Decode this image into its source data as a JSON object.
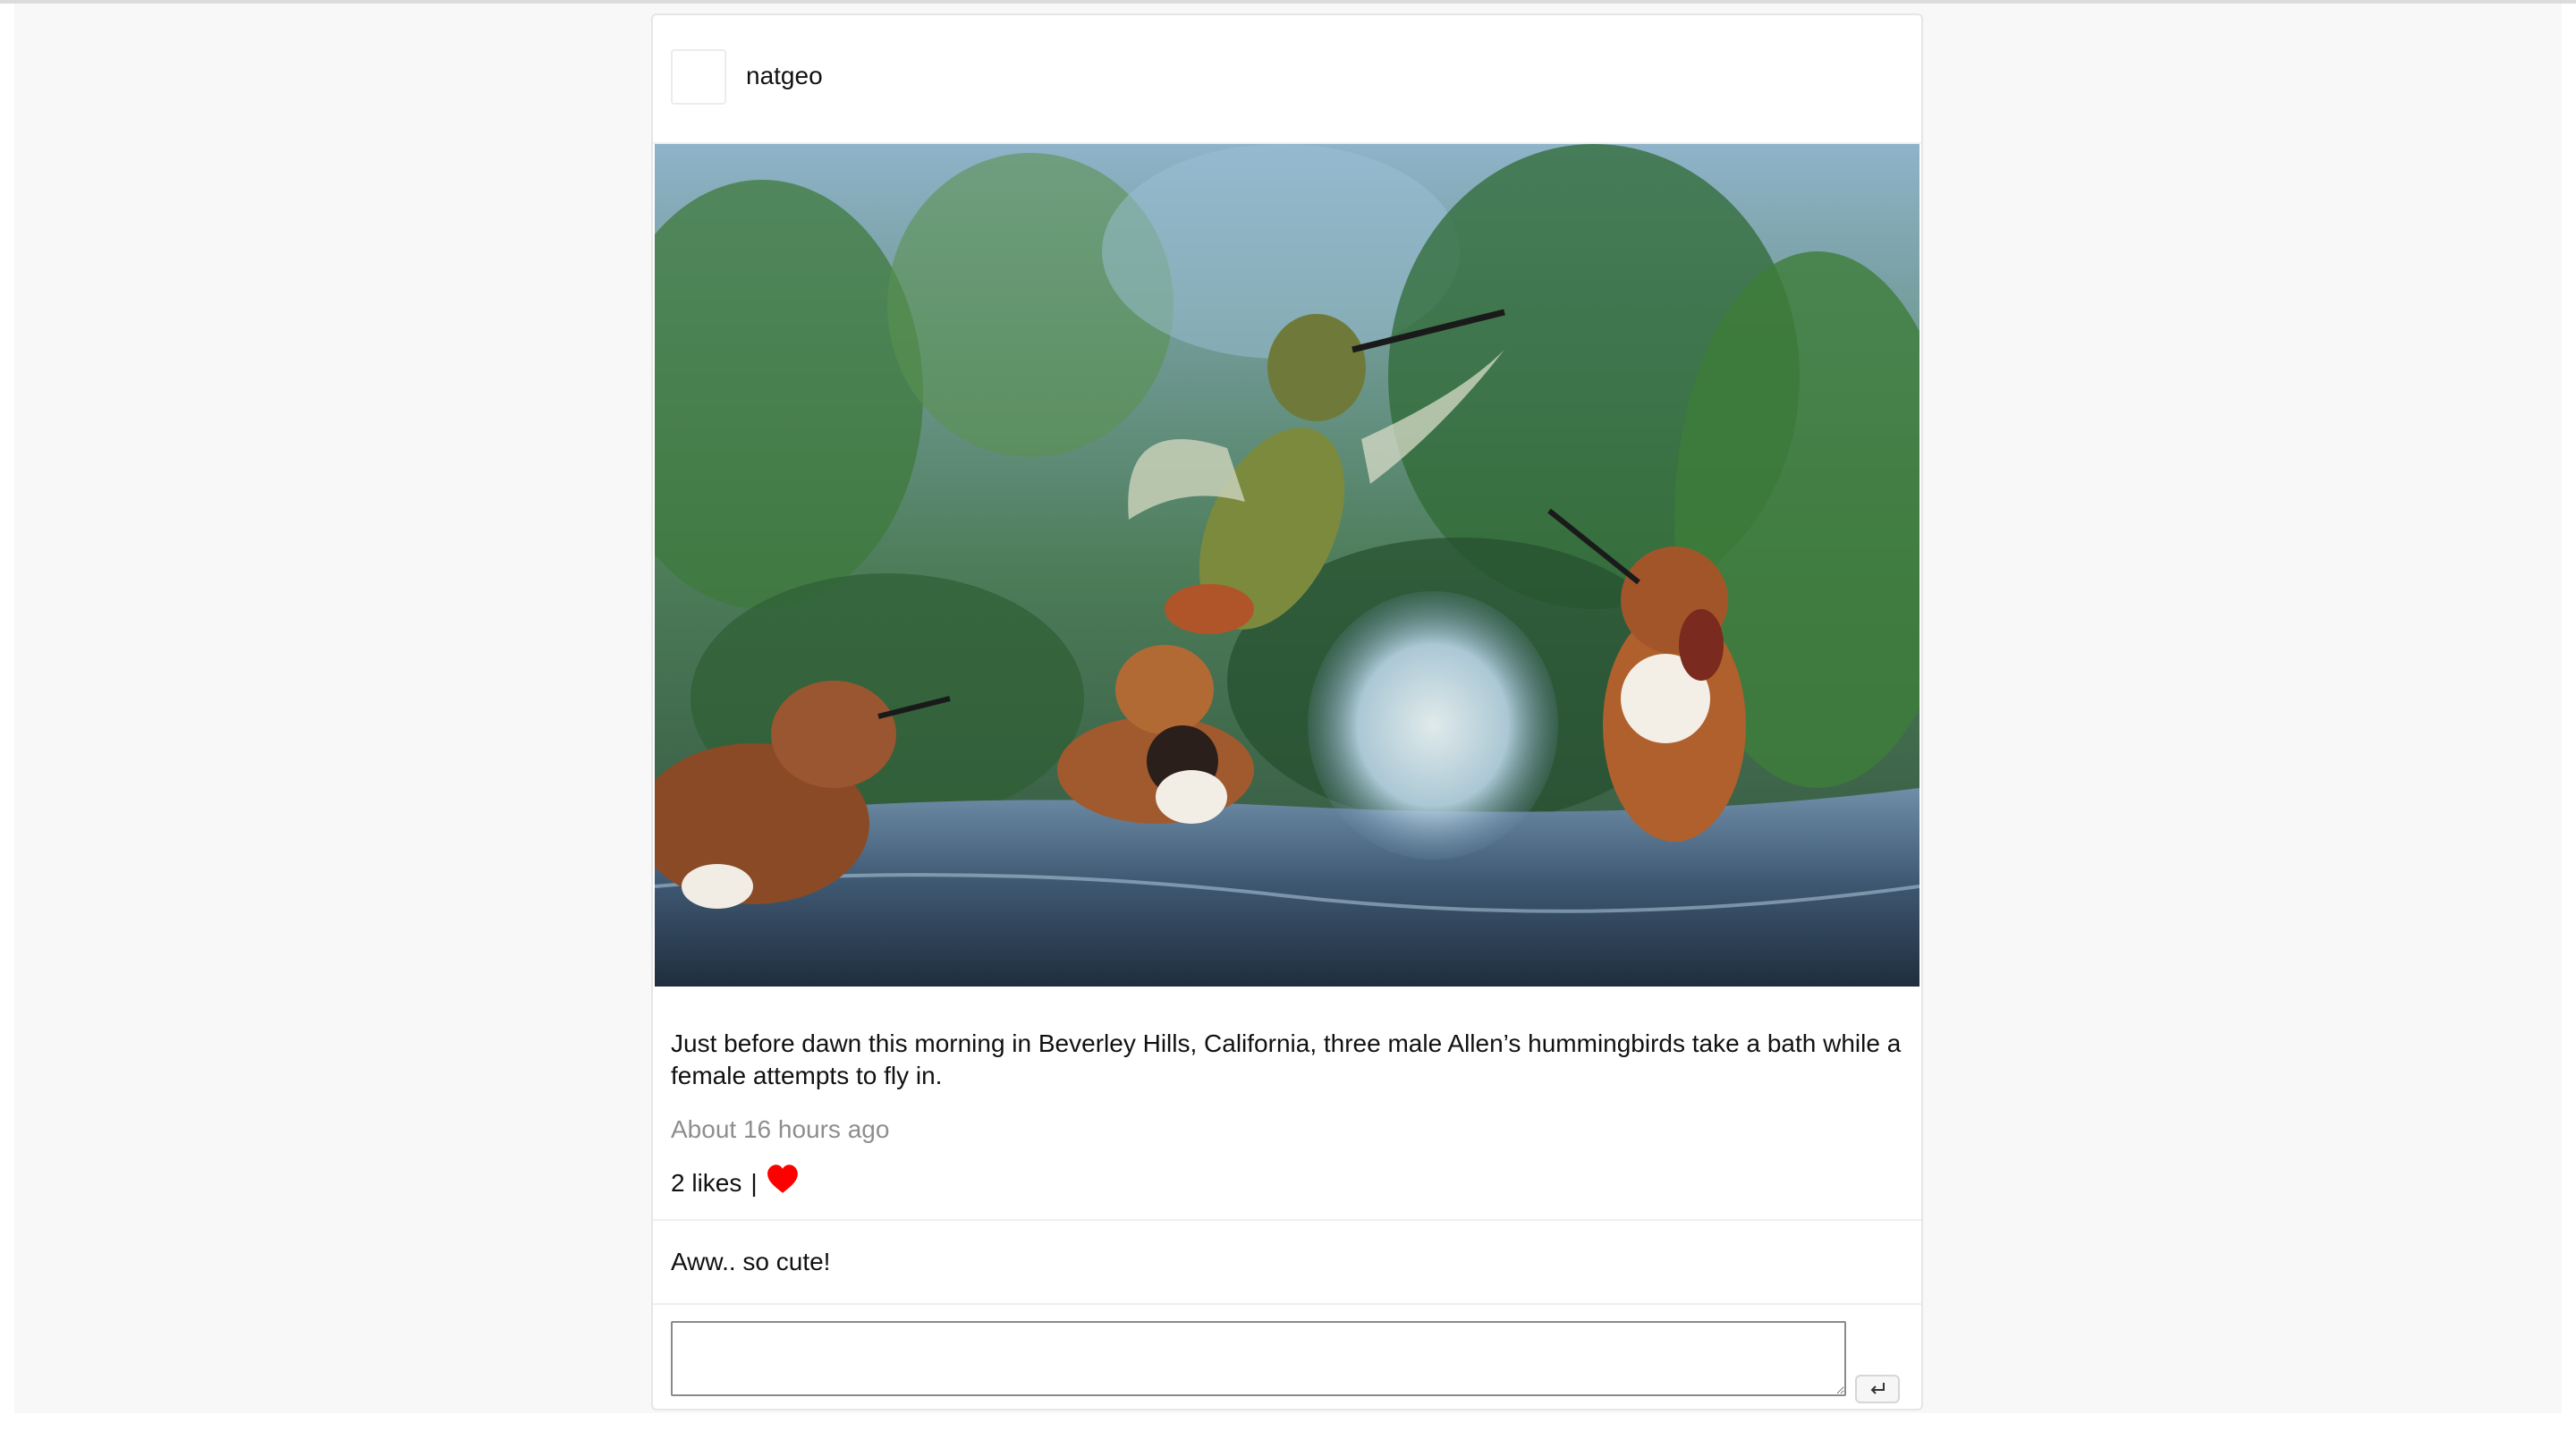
{
  "post": {
    "username": "natgeo",
    "caption": "Just before dawn this morning in Beverley Hills, California, three male Allen’s hummingbirds take a bath while a female attempts to fly in.",
    "timestamp": "About 16 hours ago",
    "likes_text": "2 likes",
    "likes_separator": "|",
    "like_icon": "heart-icon",
    "like_color": "#ff0000"
  },
  "comments": [
    {
      "text": "Aww.. so cute!"
    }
  ],
  "comment_form": {
    "value": "",
    "submit_icon": "enter-icon"
  }
}
